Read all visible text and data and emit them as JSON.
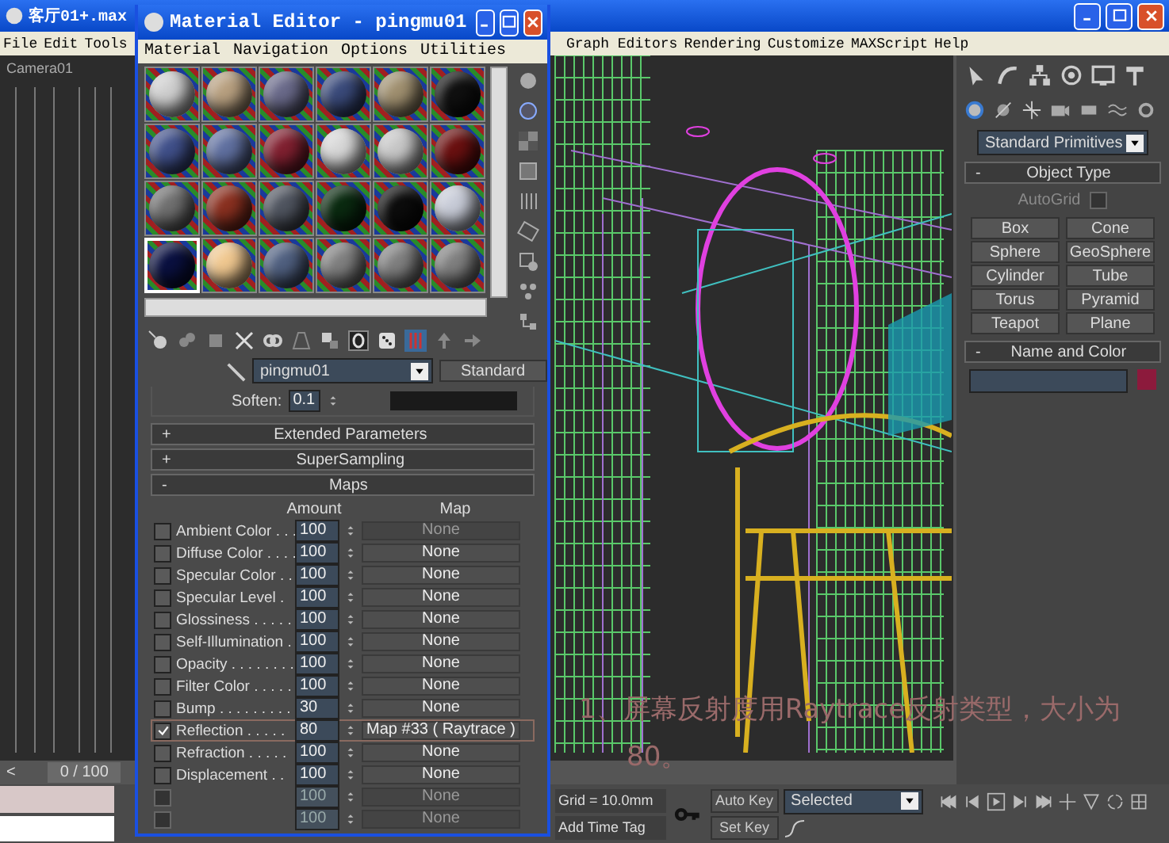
{
  "main_window": {
    "title": "客厅01+.max"
  },
  "menu_left": [
    "File",
    "Edit",
    "Tools"
  ],
  "menu_right": [
    "Graph Editors",
    "Rendering",
    "Customize",
    "MAXScript",
    "Help"
  ],
  "viewport": {
    "label": "Camera01"
  },
  "annotation": "1、屏幕反射度用Raytrace反射类型，大小为80。",
  "time_slider": {
    "arrow": "<",
    "position": "0 / 100"
  },
  "status": {
    "grid": "Grid = 10.0mm",
    "time_tag": "Add Time Tag",
    "auto_key": "Auto Key",
    "set_key": "Set Key",
    "key_filter": "Selected"
  },
  "command_panel": {
    "category": "Standard Primitives",
    "object_type": {
      "sign": "-",
      "title": "Object Type",
      "autogrid": {
        "label": "AutoGrid",
        "checked": false,
        "disabled": true
      },
      "buttons": [
        "Box",
        "Cone",
        "Sphere",
        "GeoSphere",
        "Cylinder",
        "Tube",
        "Torus",
        "Pyramid",
        "Teapot",
        "Plane"
      ]
    },
    "name_color": {
      "sign": "-",
      "title": "Name and Color"
    }
  },
  "material_editor": {
    "title": "Material Editor - pingmu01",
    "menu": [
      "Material",
      "Navigation",
      "Options",
      "Utilities"
    ],
    "slots": [
      {
        "color": "#d0d0d0",
        "selected": false
      },
      {
        "color": "#b8a080",
        "selected": false
      },
      {
        "color": "#6a6a8a",
        "selected": false
      },
      {
        "color": "#3a4a7a",
        "selected": false
      },
      {
        "color": "#a09070",
        "selected": false
      },
      {
        "color": "#101010",
        "selected": false
      },
      {
        "color": "#40508a",
        "selected": false
      },
      {
        "color": "#6070a0",
        "selected": false
      },
      {
        "color": "#802030",
        "selected": false
      },
      {
        "color": "#d8d8d8",
        "selected": false
      },
      {
        "color": "#c8c8c8",
        "selected": false
      },
      {
        "color": "#6a1010",
        "selected": false
      },
      {
        "color": "#707070",
        "selected": false
      },
      {
        "color": "#8a3020",
        "selected": false
      },
      {
        "color": "#505560",
        "selected": false
      },
      {
        "color": "#0a2a10",
        "selected": false
      },
      {
        "color": "#0c0c0c",
        "selected": false
      },
      {
        "color": "#c8ccd8",
        "selected": false
      },
      {
        "color": "#0a1040",
        "selected": true
      },
      {
        "color": "#f0c890",
        "selected": false
      },
      {
        "color": "#506080",
        "selected": false
      },
      {
        "color": "#808080",
        "selected": false
      },
      {
        "color": "#808080",
        "selected": false
      },
      {
        "color": "#808080",
        "selected": false
      }
    ],
    "material_name": "pingmu01",
    "material_type": "Standard",
    "soften": {
      "label": "Soften:",
      "value": "0.1"
    },
    "rollouts": [
      {
        "sign": "+",
        "title": "Extended Parameters"
      },
      {
        "sign": "+",
        "title": "SuperSampling"
      },
      {
        "sign": "-",
        "title": "Maps"
      }
    ],
    "maps": {
      "amount_header": "Amount",
      "map_header": "Map",
      "rows": [
        {
          "label": "Ambient Color . . .",
          "checked": false,
          "amount": "100",
          "map": "None",
          "disabled": false,
          "map_disabled": true,
          "highlighted": false
        },
        {
          "label": "Diffuse Color . . . .",
          "checked": false,
          "amount": "100",
          "map": "None",
          "disabled": false,
          "map_disabled": false,
          "highlighted": false
        },
        {
          "label": "Specular Color . .",
          "checked": false,
          "amount": "100",
          "map": "None",
          "disabled": false,
          "map_disabled": false,
          "highlighted": false
        },
        {
          "label": "Specular Level .",
          "checked": false,
          "amount": "100",
          "map": "None",
          "disabled": false,
          "map_disabled": false,
          "highlighted": false
        },
        {
          "label": "Glossiness . . . . .",
          "checked": false,
          "amount": "100",
          "map": "None",
          "disabled": false,
          "map_disabled": false,
          "highlighted": false
        },
        {
          "label": "Self-Illumination .",
          "checked": false,
          "amount": "100",
          "map": "None",
          "disabled": false,
          "map_disabled": false,
          "highlighted": false
        },
        {
          "label": "Opacity . . . . . . . .",
          "checked": false,
          "amount": "100",
          "map": "None",
          "disabled": false,
          "map_disabled": false,
          "highlighted": false
        },
        {
          "label": "Filter Color . . . . .",
          "checked": false,
          "amount": "100",
          "map": "None",
          "disabled": false,
          "map_disabled": false,
          "highlighted": false
        },
        {
          "label": "Bump . . . . . . . . .",
          "checked": false,
          "amount": "30",
          "map": "None",
          "disabled": false,
          "map_disabled": false,
          "highlighted": false
        },
        {
          "label": "Reflection . . . . .",
          "checked": true,
          "amount": "80",
          "map": "Map #33  ( Raytrace )",
          "disabled": false,
          "map_disabled": false,
          "highlighted": true
        },
        {
          "label": "Refraction . . . . .",
          "checked": false,
          "amount": "100",
          "map": "None",
          "disabled": false,
          "map_disabled": false,
          "highlighted": false
        },
        {
          "label": "Displacement . .",
          "checked": false,
          "amount": "100",
          "map": "None",
          "disabled": false,
          "map_disabled": false,
          "highlighted": false
        },
        {
          "checked": false,
          "amount": "100",
          "map": "None",
          "disabled": true,
          "map_disabled": true,
          "highlighted": false
        },
        {
          "checked": false,
          "amount": "100",
          "map": "None",
          "disabled": true,
          "map_disabled": true,
          "highlighted": false
        }
      ]
    }
  }
}
